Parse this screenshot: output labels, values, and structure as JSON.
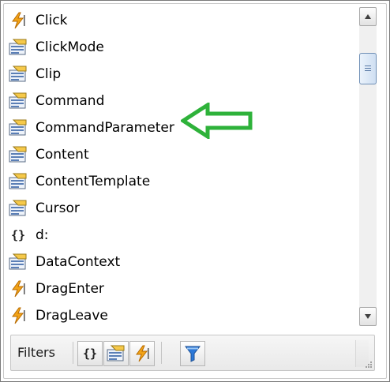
{
  "properties": {
    "items": [
      {
        "label": "Click",
        "icon": "event-icon"
      },
      {
        "label": "ClickMode",
        "icon": "property-icon"
      },
      {
        "label": "Clip",
        "icon": "property-icon"
      },
      {
        "label": "Command",
        "icon": "property-icon"
      },
      {
        "label": "CommandParameter",
        "icon": "property-icon"
      },
      {
        "label": "Content",
        "icon": "property-icon"
      },
      {
        "label": "ContentTemplate",
        "icon": "property-icon"
      },
      {
        "label": "Cursor",
        "icon": "property-icon"
      },
      {
        "label": "d:",
        "icon": "namespace-icon"
      },
      {
        "label": "DataContext",
        "icon": "property-icon"
      },
      {
        "label": "DragEnter",
        "icon": "event-icon"
      },
      {
        "label": "DragLeave",
        "icon": "event-icon"
      }
    ]
  },
  "filters": {
    "label": "Filters",
    "buttons": [
      "namespace-filter-icon",
      "property-filter-icon",
      "event-filter-icon",
      "funnel-icon"
    ]
  },
  "colors": {
    "arrow": "#2eb23a",
    "event": "#f0a020",
    "funnel": "#2b78d8"
  }
}
